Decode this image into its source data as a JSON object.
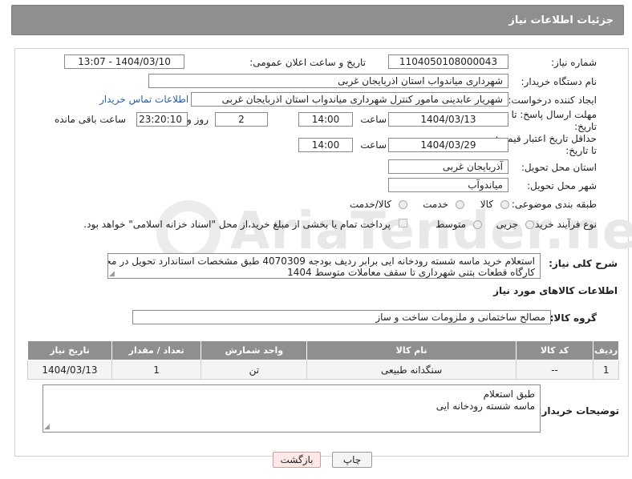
{
  "header": {
    "title": "جزئیات اطلاعات نیاز"
  },
  "form": {
    "need_number": {
      "label": "شماره نیاز:",
      "value": "1104050108000043"
    },
    "announce": {
      "label": "تاریخ و ساعت اعلان عمومی:",
      "value": "1404/03/10 - 13:07"
    },
    "buyer_org": {
      "label": "نام دستگاه خریدار:",
      "value": "شهرداری میاندواب استان اذربایجان غربی"
    },
    "creator": {
      "label": "ایجاد کننده درخواست:",
      "value": "شهریار  عابدینی مامور کنترل شهرداری میاندواب استان اذربایجان غربی",
      "contact_link": "اطلاعات تماس خریدار"
    },
    "reply_deadline": {
      "label_line1": "مهلت ارسال پاسخ: تا",
      "label_line2": "تاریخ:",
      "date": "1404/03/13",
      "time_label": "ساعت",
      "time": "14:00",
      "days": "2",
      "days_label": "روز و",
      "remaining": "23:20:10",
      "remaining_label": "ساعت باقی مانده"
    },
    "price_deadline": {
      "label_line1": "حداقل تاریخ اعتبار قیمت:",
      "label_line2": "تا تاریخ:",
      "date": "1404/03/29",
      "time_label": "ساعت",
      "time": "14:00"
    },
    "delivery_province": {
      "label": "استان محل تحویل:",
      "value": "آذربایجان غربی"
    },
    "delivery_city": {
      "label": "شهر محل تحویل:",
      "value": "میاندوآب"
    },
    "category": {
      "label": "طبقه بندی موضوعی:",
      "options": [
        "کالا",
        "خدمت",
        "کالا/خدمت"
      ]
    },
    "process": {
      "label": "نوع فرآیند خرید :",
      "options": [
        "جزیی",
        "متوسط"
      ],
      "note": "پرداخت تمام یا بخشی از مبلغ خرید،از محل \"اسناد خزانه اسلامی\" خواهد بود."
    }
  },
  "summary": {
    "label": "شرح کلی نیاز:",
    "line1": "استعلام خرید ماسه شسته رودخانه ایی برابر ردیف بودجه 4070309 طبق مشخصات استاندارد تحویل در محل",
    "line2": "کارگاه قطعات بتنی شهرداری تا سقف معاملات متوسط 1404"
  },
  "goods_info": {
    "title": "اطلاعات کالاهای مورد نیاز"
  },
  "goods_group": {
    "label": "گروه کالا:",
    "value": "مصالح ساختمانی و ملزومات ساخت و ساز"
  },
  "table": {
    "headers": {
      "row": "ردیف",
      "code": "کد کالا",
      "name": "نام کالا",
      "unit": "واحد شمارش",
      "qty": "تعداد / مقدار",
      "date": "تاریخ نیاز"
    },
    "rows": [
      {
        "row": "1",
        "code": "--",
        "name": "سنگدانه طبیعی",
        "unit": "تن",
        "qty": "1",
        "date": "1404/03/13"
      }
    ]
  },
  "buyer_notes": {
    "label": "توضیحات خریدار:",
    "line1": "طبق استعلام",
    "line2": "ماسه شسته رودخانه ایی"
  },
  "buttons": {
    "print": "چاپ",
    "back": "بازگشت"
  },
  "watermark": {
    "text": "AriaTender.net"
  },
  "colors": {
    "header_bg": "#8f8f8f",
    "link": "#2a5ea8",
    "back_button_bg": "#fde8e8"
  }
}
